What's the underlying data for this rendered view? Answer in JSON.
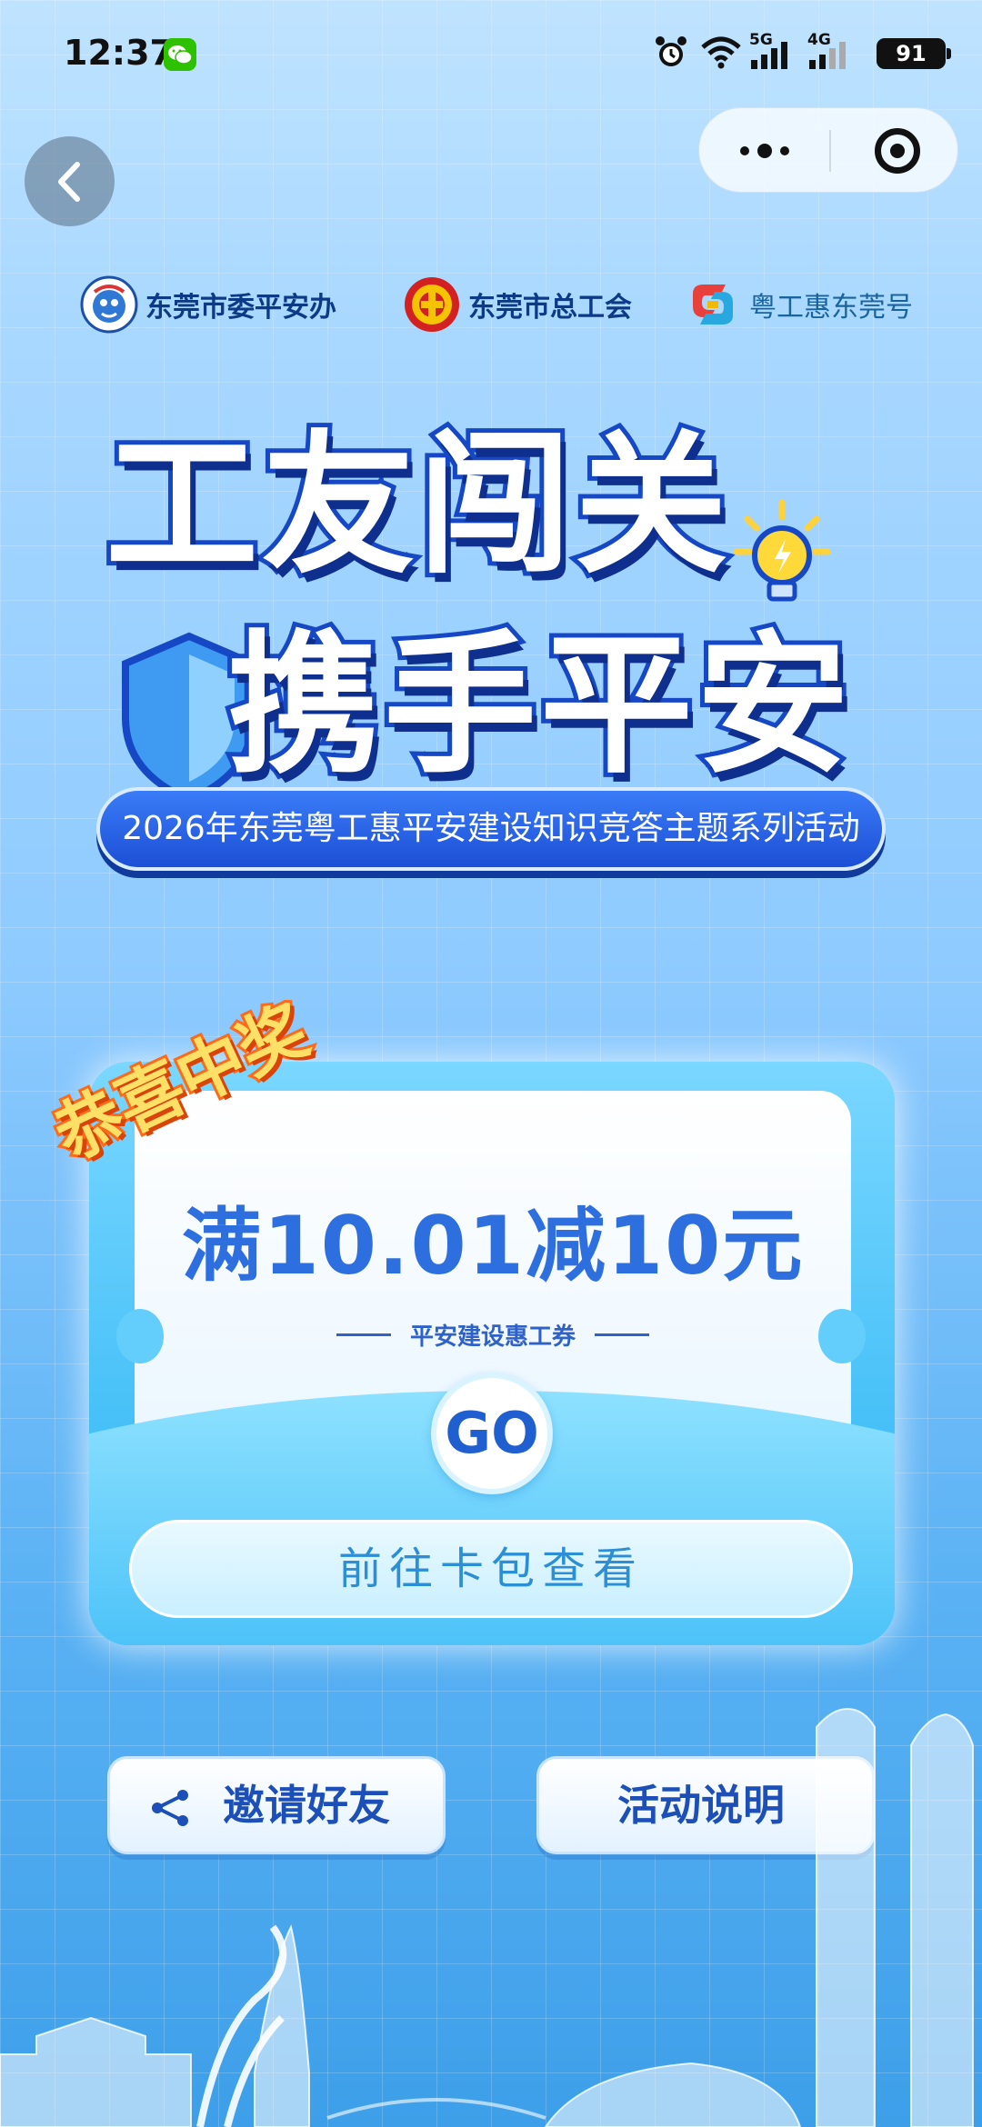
{
  "status_bar": {
    "time": "12:37",
    "network_1": "5G",
    "network_2": "4G",
    "battery": "91"
  },
  "nav": {
    "back_icon": "back-arrow-icon",
    "more_icon": "more-dots-icon",
    "close_icon": "target-close-icon"
  },
  "sponsors": [
    {
      "label": "东莞市委平安办"
    },
    {
      "label": "东莞市总工会"
    },
    {
      "label": "粤工惠东莞号"
    }
  ],
  "hero": {
    "title_line1": "工友闯关",
    "title_line2": "携手平安",
    "subtitle": "2026年东莞粤工惠平安建设知识竞答主题系列活动"
  },
  "prize": {
    "ribbon": "恭喜中奖",
    "amount": "满10.01减10元",
    "coupon_name": "平安建设惠工券",
    "go_label": "GO",
    "wallet_button": "前往卡包查看"
  },
  "actions": {
    "invite_label": "邀请好友",
    "rules_label": "活动说明"
  },
  "colors": {
    "accent": "#1c4fd6",
    "coupon_text": "#2e6fe0",
    "ribbon": "#ff6a18"
  }
}
